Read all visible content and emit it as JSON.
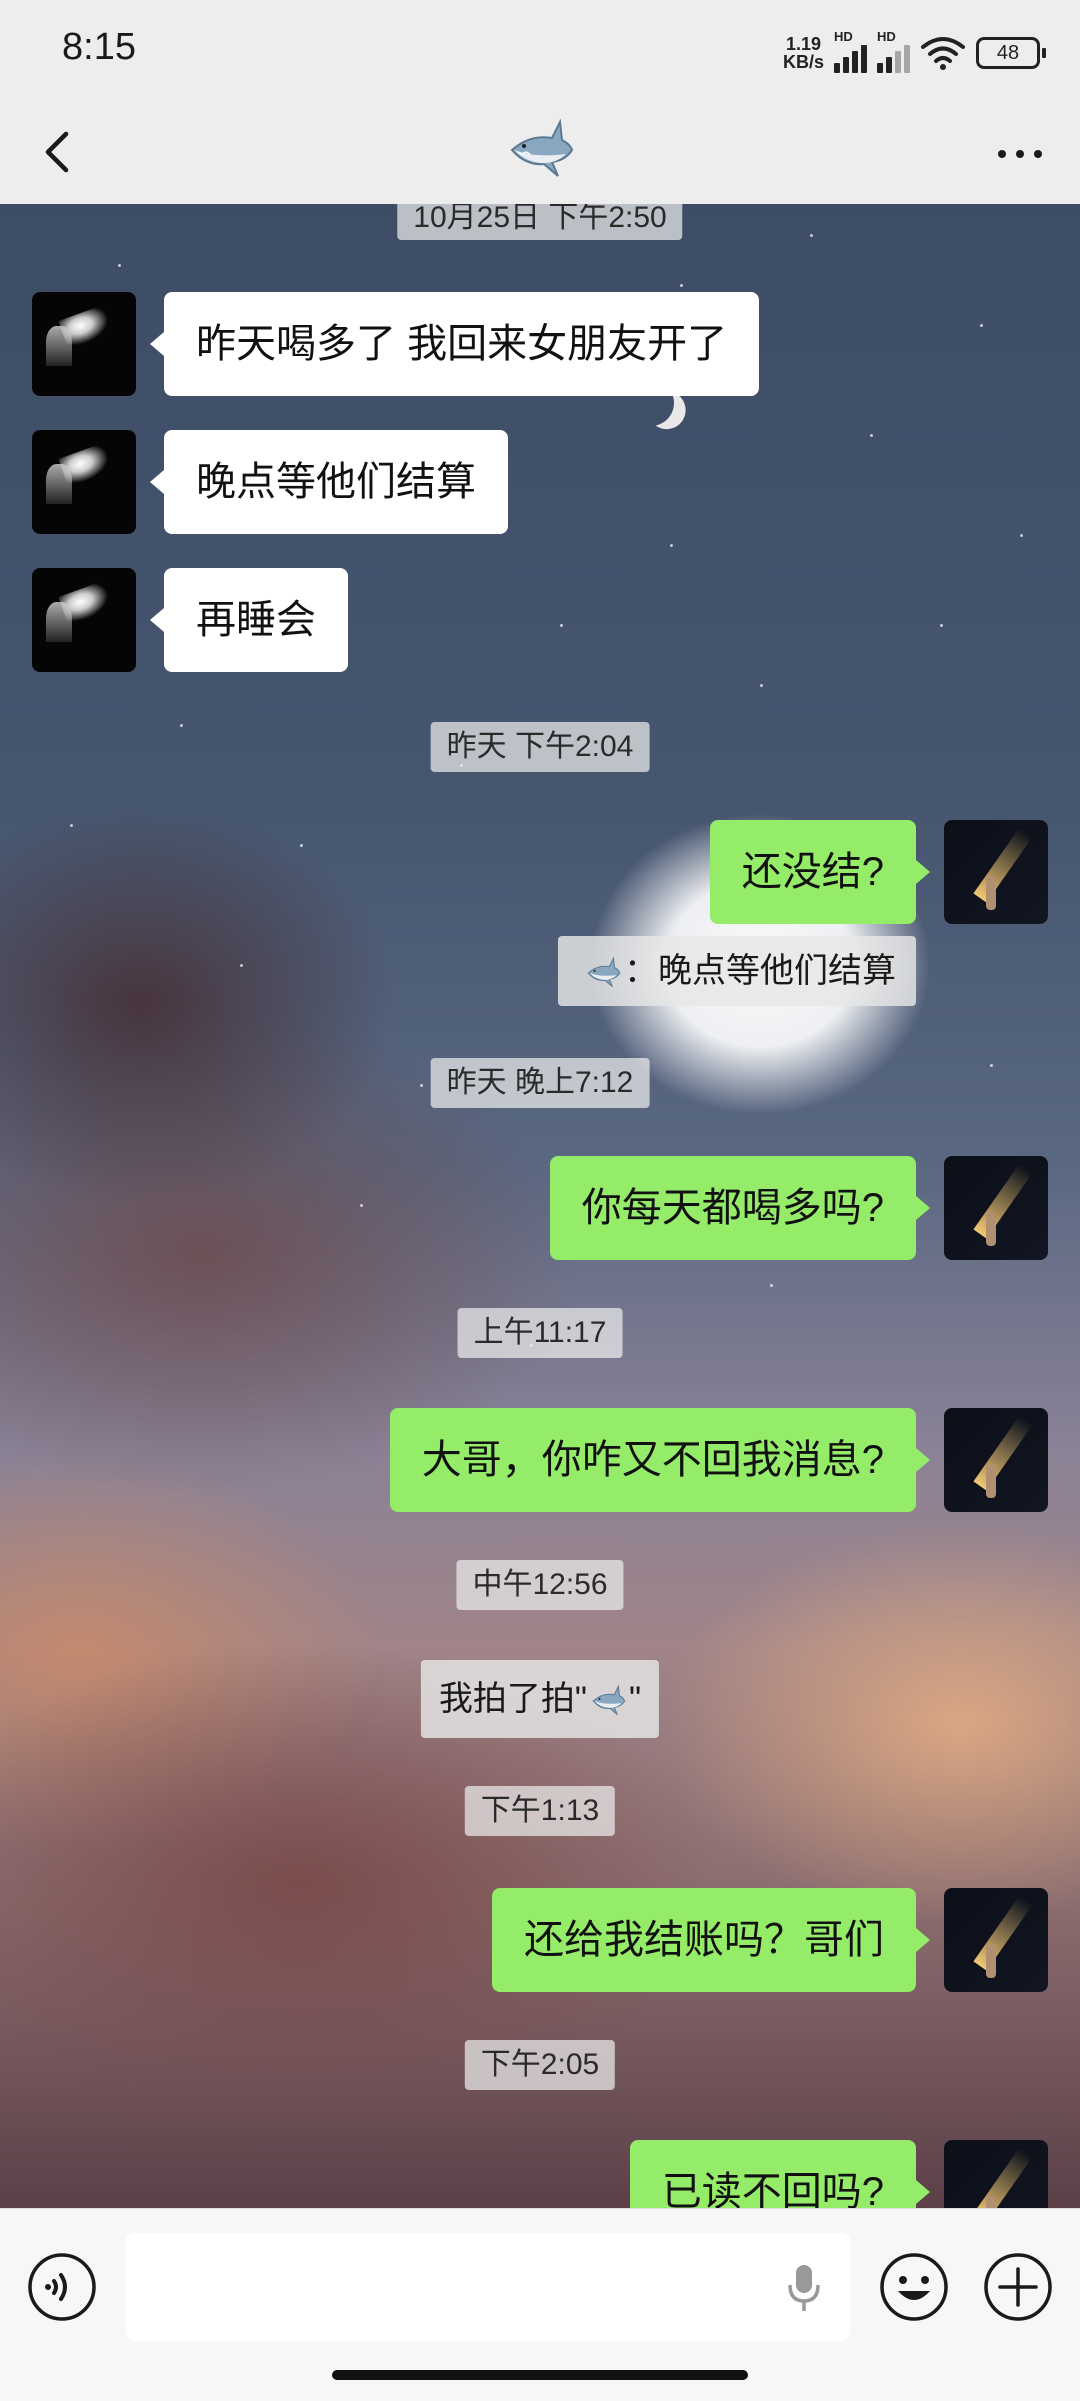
{
  "status_bar": {
    "time": "8:15",
    "net_speed_value": "1.19",
    "net_speed_unit": "KB/s",
    "signal1_label": "HD",
    "signal2_label": "HD",
    "battery": "48"
  },
  "header": {
    "title_icon": "shark-emoji-icon"
  },
  "messages": {
    "ts0": "10月25日 下午2:50",
    "m1": "昨天喝多了 我回来女朋友开了",
    "m2": "晚点等他们结算",
    "m3": "再睡会",
    "ts1": "昨天 下午2:04",
    "m4": "还没结?",
    "quote_text": "：晚点等他们结算",
    "ts2": "昨天 晚上7:12",
    "m5": "你每天都喝多吗?",
    "ts3": "上午11:17",
    "m6": "大哥，你咋又不回我消息?",
    "ts4": "中午12:56",
    "pat_prefix": "我拍了拍\"",
    "pat_suffix": "\"",
    "ts5": "下午1:13",
    "m7": "还给我结账吗？哥们",
    "ts6": "下午2:05",
    "m8": "已读不回吗?"
  },
  "input": {
    "placeholder": ""
  },
  "colors": {
    "sent_bubble": "#95ec69",
    "received_bubble": "#ffffff",
    "bar_background": "#ededed"
  }
}
